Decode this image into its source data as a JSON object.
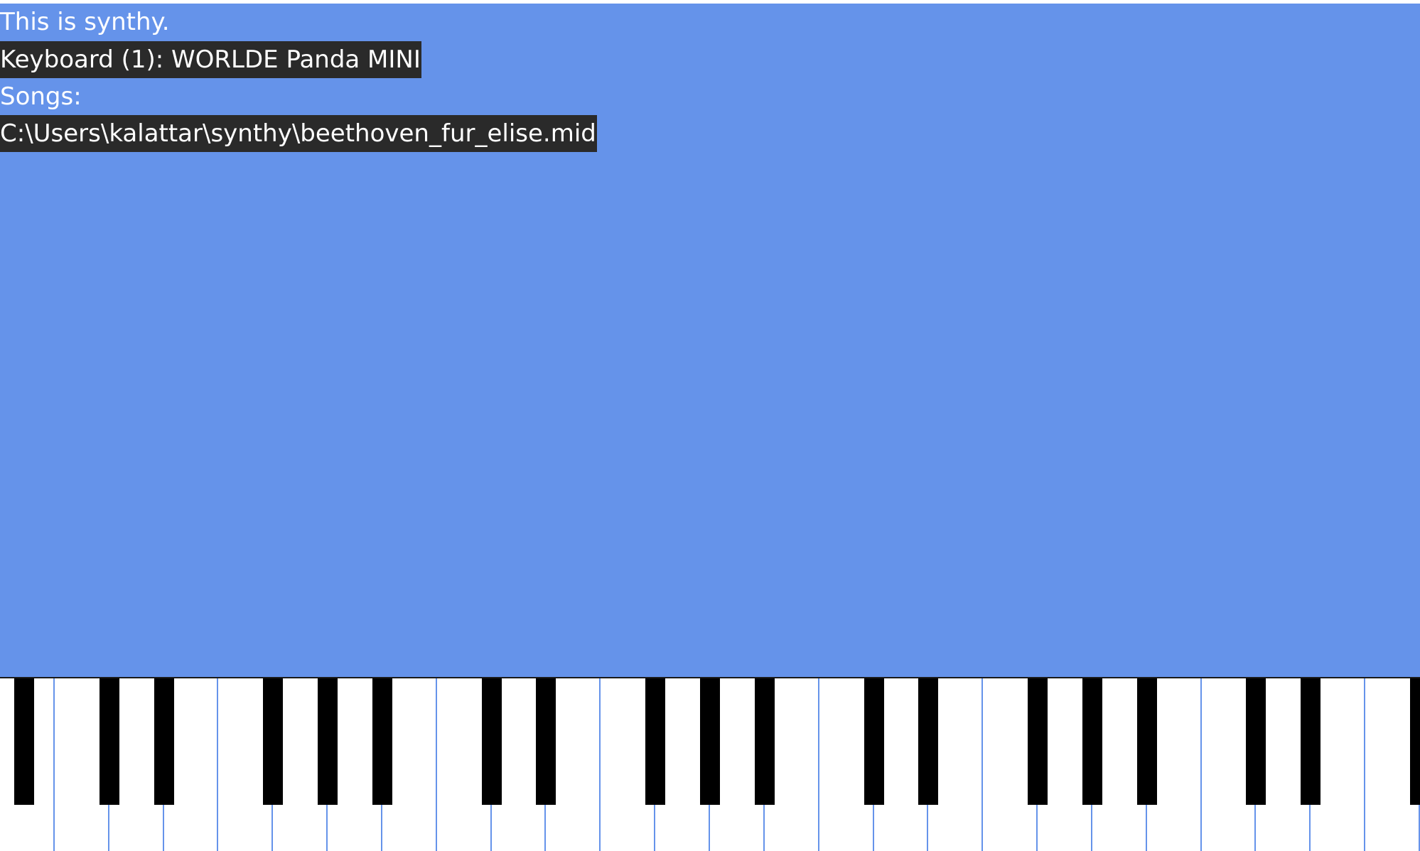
{
  "app": {
    "background_color": "#6593ea",
    "highlight_color": "#2a2a2a",
    "text_color": "#ffffff",
    "title": "This is synthy.",
    "keyboard_device": "Keyboard (1): WORLDE Panda MINI",
    "songs_label": "Songs:",
    "songs": [
      "C:\\Users\\kalattar\\synthy\\beethoven_fur_elise.mid"
    ]
  },
  "piano": {
    "white_key_color": "#ffffff",
    "black_key_color": "#000000",
    "separator_color": "#6593ea"
  }
}
